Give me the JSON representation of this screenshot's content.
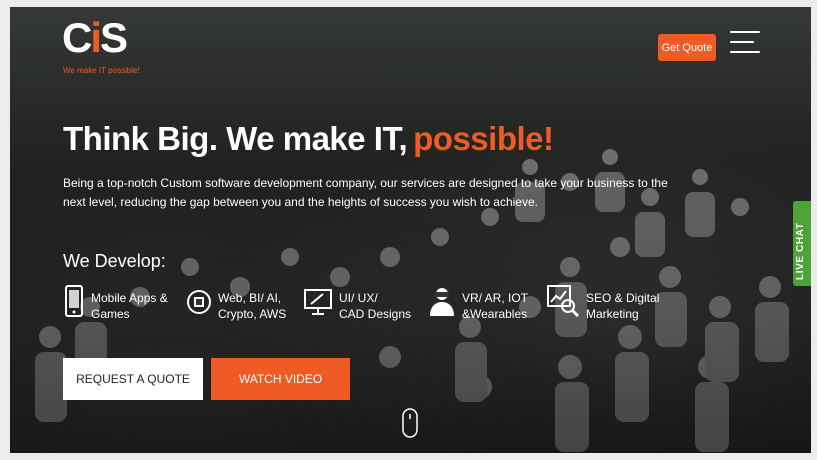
{
  "header": {
    "logo_text": "CiS",
    "logo_tagline_prefix": "We make IT ",
    "logo_tagline_accent": "possible!",
    "get_quote_label": "Get Quote",
    "menu_icon": "hamburger-menu-icon"
  },
  "hero": {
    "headline_main": "Think Big. We make IT,",
    "headline_accent": "possible!",
    "description": "Being a top-notch Custom software development company, our services are designed to take your business to the next level, reducing the gap between you and the heights of success you wish to achieve.",
    "develop_heading": "We Develop:",
    "services": [
      {
        "icon": "mobile-phone-icon",
        "line1": "Mobile Apps &",
        "line2": "Games"
      },
      {
        "icon": "chip-icon",
        "line1": "Web, BI/ AI,",
        "line2": "Crypto, AWS"
      },
      {
        "icon": "design-monitor-icon",
        "line1": "UI/ UX/",
        "line2": "CAD Designs"
      },
      {
        "icon": "vr-headset-icon",
        "line1": "VR/ AR, IOT",
        "line2": "&Wearables"
      },
      {
        "icon": "seo-analytics-icon",
        "line1": "SEO & Digital",
        "line2": "Marketing"
      }
    ],
    "request_quote_label": "REQUEST A QUOTE",
    "watch_video_label": "WATCH VIDEO",
    "scroll_icon": "mouse-scroll-icon"
  },
  "live_chat": {
    "label": "LIVE CHAT"
  },
  "colors": {
    "accent": "#ef5b25",
    "live_chat": "#4da338",
    "text": "#ffffff"
  }
}
